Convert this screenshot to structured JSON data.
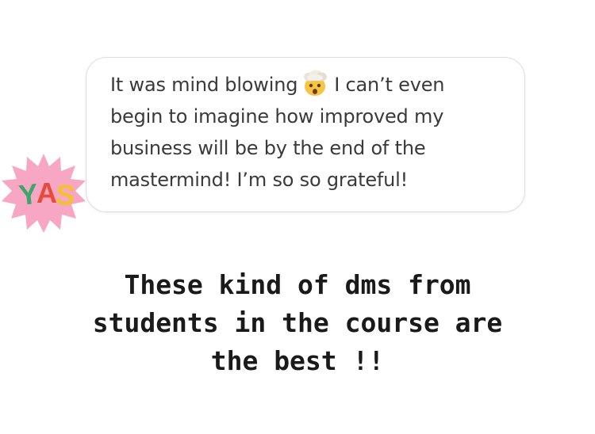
{
  "dm": {
    "lines": [
      "It was mind blowing",
      "I can’t even",
      "begin to imagine how improved my",
      "business will be by the end of the",
      "mastermind! I’m so so grateful!"
    ],
    "emoji": "exploding-head-icon"
  },
  "sticker": {
    "text": "YAS",
    "colors": {
      "burst": "#f7a6c3",
      "Y": "#3aa86b",
      "A": "#e84a3c",
      "S": "#f2c12e"
    }
  },
  "caption": {
    "lines": [
      "These kind of dms from",
      "students in the course are",
      "the best !!"
    ]
  }
}
